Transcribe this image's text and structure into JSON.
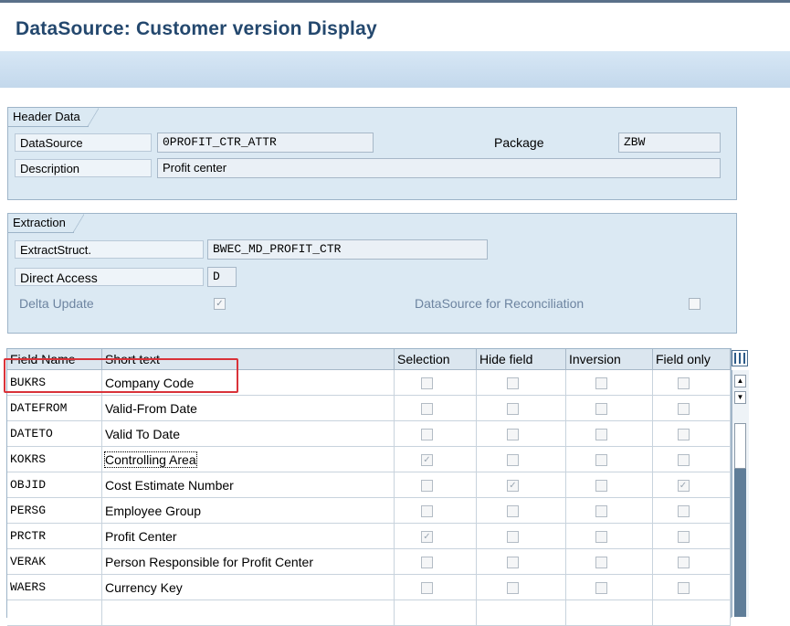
{
  "window": {
    "title": "DataSource: Customer version Display"
  },
  "header_group": {
    "tab": "Header Data",
    "datasource_label": "DataSource",
    "datasource_value": "0PROFIT_CTR_ATTR",
    "package_label": "Package",
    "package_value": "ZBW",
    "description_label": "Description",
    "description_value": "Profit center"
  },
  "extraction_group": {
    "tab": "Extraction",
    "extract_label": "ExtractStruct.",
    "extract_value": "BWEC_MD_PROFIT_CTR",
    "direct_label": "Direct Access",
    "direct_value": "D",
    "delta_label": "Delta Update",
    "delta_checked": true,
    "recon_label": "DataSource for Reconciliation",
    "recon_checked": false
  },
  "table": {
    "columns": [
      "Field Name",
      "Short text",
      "Selection",
      "Hide field",
      "Inversion",
      "Field only"
    ],
    "rows": [
      {
        "field": "BUKRS",
        "text": "Company Code",
        "selection": false,
        "hide": false,
        "inversion": false,
        "field_only": false
      },
      {
        "field": "DATEFROM",
        "text": "Valid-From Date",
        "selection": false,
        "hide": false,
        "inversion": false,
        "field_only": false
      },
      {
        "field": "DATETO",
        "text": "Valid To Date",
        "selection": false,
        "hide": false,
        "inversion": false,
        "field_only": false
      },
      {
        "field": "KOKRS",
        "text": "Controlling Area",
        "selection": true,
        "hide": false,
        "inversion": false,
        "field_only": false
      },
      {
        "field": "OBJID",
        "text": "Cost Estimate Number",
        "selection": false,
        "hide": true,
        "inversion": false,
        "field_only": true
      },
      {
        "field": "PERSG",
        "text": "Employee Group",
        "selection": false,
        "hide": false,
        "inversion": false,
        "field_only": false
      },
      {
        "field": "PRCTR",
        "text": "Profit Center",
        "selection": true,
        "hide": false,
        "inversion": false,
        "field_only": false
      },
      {
        "field": "VERAK",
        "text": "Person Responsible for Profit Center",
        "selection": false,
        "hide": false,
        "inversion": false,
        "field_only": false
      },
      {
        "field": "WAERS",
        "text": "Currency Key",
        "selection": false,
        "hide": false,
        "inversion": false,
        "field_only": false
      },
      {
        "field": "",
        "text": "",
        "selection": null,
        "hide": null,
        "inversion": null,
        "field_only": null
      }
    ]
  },
  "icons": {
    "column_config": "table-settings-icon",
    "scroll_up": "arrow-up-icon",
    "scroll_down": "arrow-down-icon"
  },
  "colors": {
    "title": "#24486e",
    "group_bg": "#dbe9f3",
    "highlight": "#d9333a"
  }
}
